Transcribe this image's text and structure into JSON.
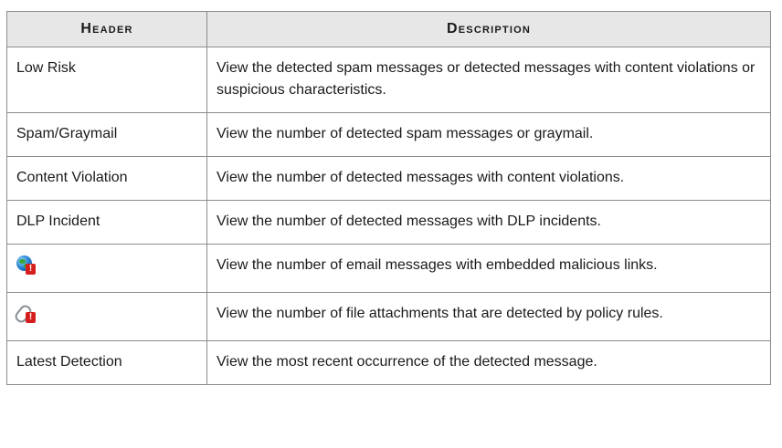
{
  "table": {
    "header_col1": "Header",
    "header_col2": "Description",
    "rows": [
      {
        "header": "Low Risk",
        "description": "View the detected spam messages or detected messages with content violations or suspicious characteristics."
      },
      {
        "header": "Spam/Graymail",
        "description": "View the number of detected spam messages or graymail."
      },
      {
        "header": "Content Violation",
        "description": "View the number of detected messages with content violations."
      },
      {
        "header": "DLP Incident",
        "description": "View the number of detected messages with DLP incidents."
      },
      {
        "header_icon": "malicious-link-globe-icon",
        "description": "View the number of email messages with embedded malicious links."
      },
      {
        "header_icon": "malicious-attachment-paperclip-icon",
        "description": "View the number of file attachments that are detected by policy rules."
      },
      {
        "header": "Latest Detection",
        "description": "View the most recent occurrence of the detected message."
      }
    ]
  },
  "colors": {
    "header_bg": "#e7e7e7",
    "border": "#8c8c8c",
    "alert_red": "#d51e1e"
  }
}
